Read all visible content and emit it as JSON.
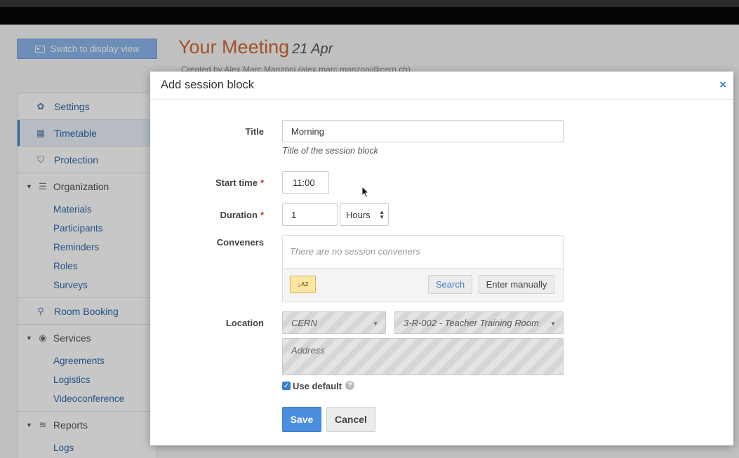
{
  "page": {
    "switch_label": "Switch to display view",
    "meeting_title": "Your Meeting",
    "meeting_date": "21 Apr",
    "created_by": "Created by Alex Marc Manzoni (alex.marc.manzoni@cern.ch)"
  },
  "sidebar": {
    "settings": "Settings",
    "timetable": "Timetable",
    "protection": "Protection",
    "organization": "Organization",
    "organization_items": [
      "Materials",
      "Participants",
      "Reminders",
      "Roles",
      "Surveys"
    ],
    "room_booking": "Room Booking",
    "services": "Services",
    "services_items": [
      "Agreements",
      "Logistics",
      "Videoconference"
    ],
    "reports": "Reports",
    "reports_items": [
      "Logs"
    ]
  },
  "dialog": {
    "title": "Add session block",
    "close": "×",
    "title_label": "Title",
    "title_value": "Morning",
    "title_help": "Title of the session block",
    "start_label": "Start time",
    "start_value": "11:00",
    "duration_label": "Duration",
    "duration_value": "1",
    "duration_unit": "Hours",
    "conveners_label": "Conveners",
    "conveners_empty": "There are no session conveners",
    "search_label": "Search",
    "enter_manually_label": "Enter manually",
    "location_label": "Location",
    "venue": "CERN",
    "room": "3-R-002 - Teacher Training Room",
    "address_placeholder": "Address",
    "use_default_label": "Use default",
    "save_label": "Save",
    "cancel_label": "Cancel",
    "required_mark": "*"
  },
  "colors": {
    "accent": "#4a8ee0",
    "title_orange": "#d06a35",
    "required": "#c0392b",
    "link": "#2f6aaa"
  },
  "icons": {
    "settings": "gear-icon",
    "timetable": "calendar-icon",
    "protection": "shield-icon",
    "organization": "list-icon",
    "room_booking": "map-pin-icon",
    "services": "broadcast-icon",
    "reports": "layers-icon",
    "sort": "sort-alpha-icon",
    "help": "question-circle-icon",
    "close": "close-icon",
    "cursor": "mouse-pointer-icon"
  }
}
